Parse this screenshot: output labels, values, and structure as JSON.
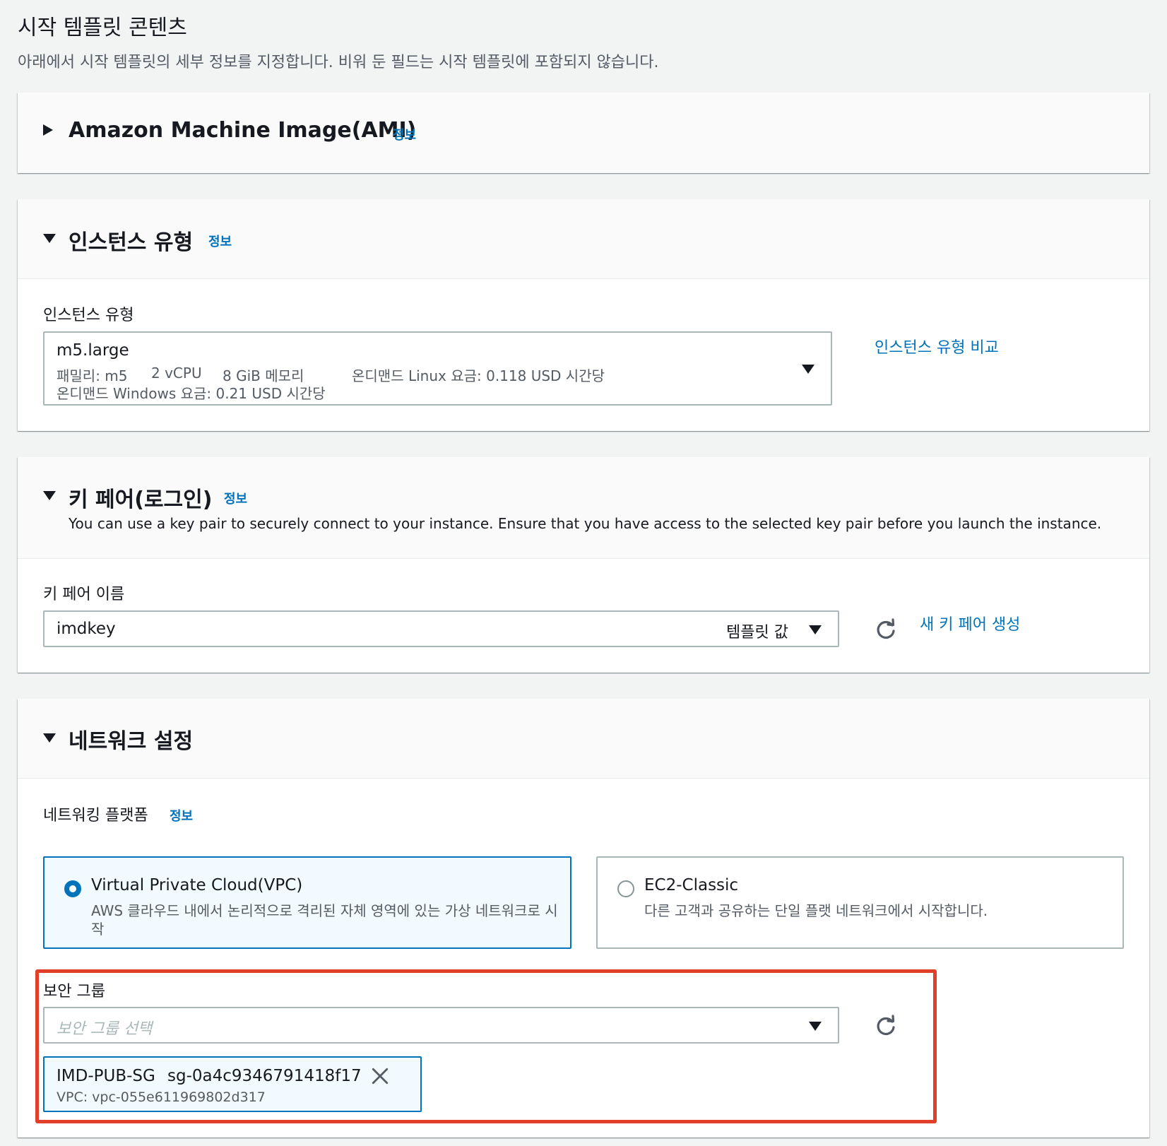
{
  "page": {
    "title": "시작 템플릿 콘텐츠",
    "description": "아래에서 시작 템플릿의 세부 정보를 지정합니다. 비워 둔 필드는 시작 템플릿에 포함되지 않습니다."
  },
  "ami": {
    "title": "Amazon Machine Image(AMI)",
    "info": "정보",
    "caret_icon": "caret-right-icon"
  },
  "instance_type": {
    "title": "인스턴스 유형",
    "info": "정보",
    "field_label": "인스턴스 유형",
    "selected_value": "m5.large",
    "family": "패밀리: m5",
    "vcpu": "2 vCPU",
    "memory": "8 GiB 메모리",
    "linux_price": "온디맨드 Linux 요금: 0.118 USD 시간당",
    "windows_price": "온디맨드 Windows 요금: 0.21 USD 시간당",
    "compare_link": "인스턴스 유형 비교"
  },
  "key_pair": {
    "title": "키 페어(로그인)",
    "info": "정보",
    "description": "You can use a key pair to securely connect to your instance. Ensure that you have access to the selected key pair before you launch the instance.",
    "field_label": "키 페어 이름",
    "selected_value": "imdkey",
    "template_tag": "템플릿 값",
    "create_link": "새 키 페어 생성"
  },
  "network": {
    "title": "네트워크 설정",
    "platform_label": "네트워킹 플랫폼",
    "info": "정보",
    "options": [
      {
        "title": "Virtual Private Cloud(VPC)",
        "desc_line1": "AWS 클라우드 내에서 논리적으로 격리된 자체 영역에 있는 가상 네트워크로 시",
        "desc_line2": "작",
        "selected": true
      },
      {
        "title": "EC2-Classic",
        "desc_line1": "다른 고객과 공유하는 단일 플랫 네트워크에서 시작합니다.",
        "selected": false
      }
    ],
    "security_group": {
      "label": "보안 그룹",
      "placeholder": "보안 그룹 선택",
      "token_name": "IMD-PUB-SG",
      "token_id": "sg-0a4c9346791418f17",
      "token_vpc": "VPC: vpc-055e611969802d317"
    }
  },
  "colors": {
    "link": "#0073bb",
    "highlight_border": "#e0402a",
    "selected_card_bg": "#f1faff",
    "selected_card_border": "#0073bb"
  }
}
